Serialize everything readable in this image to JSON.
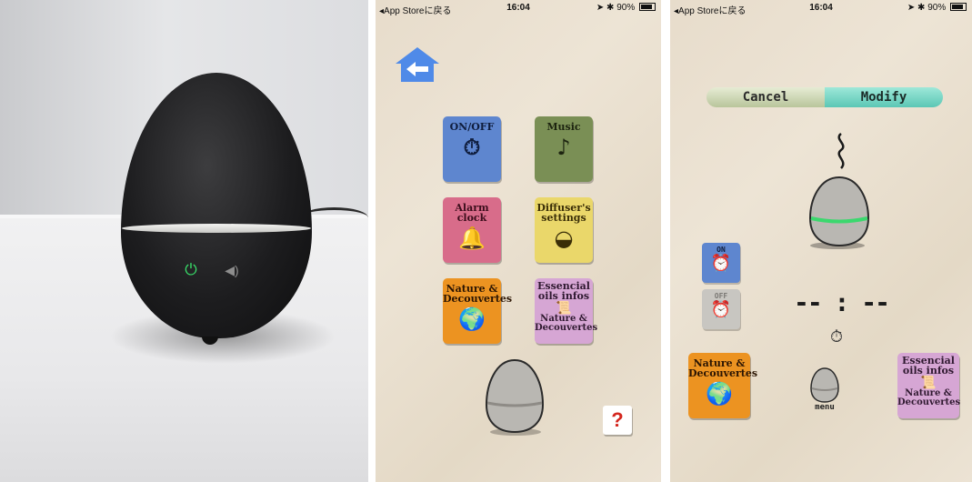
{
  "status_bar": {
    "back_label": "◂App Storeに戻る",
    "time": "16:04",
    "battery": "90%"
  },
  "photo": {
    "power_symbol": "⏻",
    "sound_symbol": "◀)"
  },
  "menu_screen": {
    "tiles": {
      "onoff": {
        "label": "ON/OFF",
        "icon": "⏱"
      },
      "music": {
        "label": "Music",
        "icon": "♪"
      },
      "alarm": {
        "label": "Alarm clock",
        "icon": "🔔"
      },
      "settings": {
        "label": "Diffuser's settings",
        "icon": "◒"
      },
      "nature": {
        "label": "Nature & Decouvertes",
        "icon": "🌍"
      },
      "oils": {
        "label": "Essencial oils infos",
        "sub": "Nature & Decouvertes",
        "icon": "📜"
      }
    },
    "help_label": "?"
  },
  "timer_screen": {
    "cancel_label": "Cancel",
    "modify_label": "Modify",
    "on_label": "ON",
    "off_label": "OFF",
    "time_display": "-- : --",
    "menu_label": "menu",
    "nature_label": "Nature & Decouvertes",
    "oils_label": "Essencial oils infos",
    "oils_sub": "Nature & Decouvertes"
  },
  "colors": {
    "accent_blue": "#5e86cf",
    "led_green": "#3bd86e",
    "help_red": "#d4261e"
  }
}
